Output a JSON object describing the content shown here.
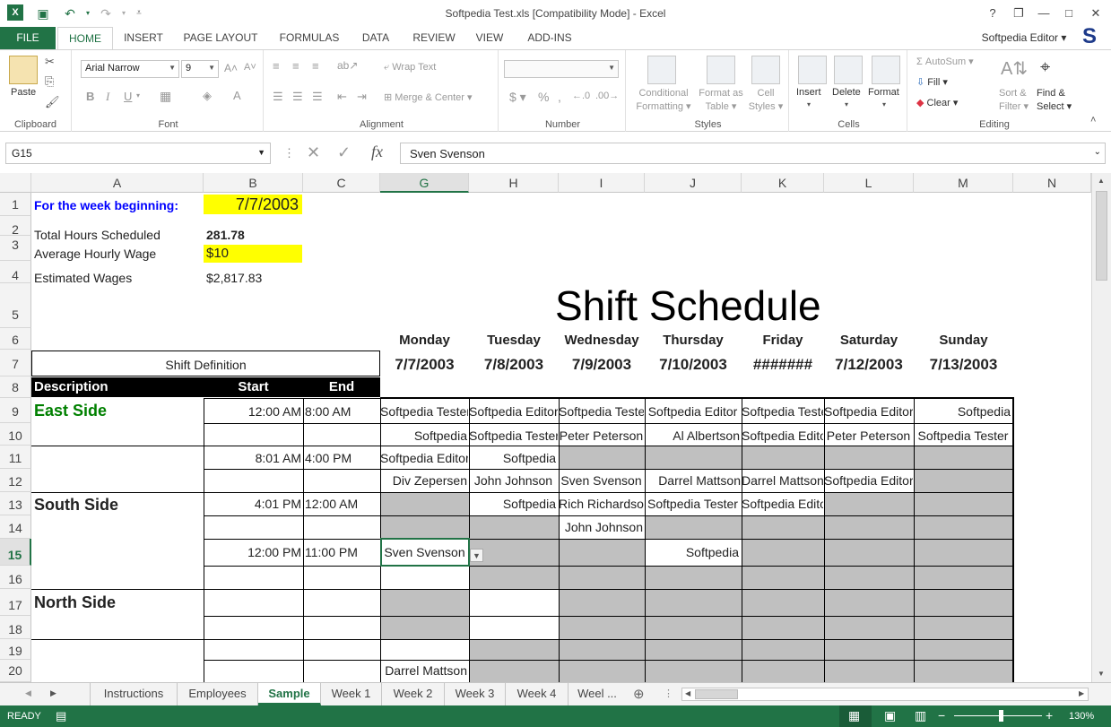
{
  "window": {
    "title": "Softpedia Test.xls  [Compatibility Mode] - Excel",
    "help": "?",
    "minimize": "—",
    "restore": "❐",
    "close": "✕"
  },
  "ribbon_tabs": [
    "FILE",
    "HOME",
    "INSERT",
    "PAGE LAYOUT",
    "FORMULAS",
    "DATA",
    "REVIEW",
    "VIEW",
    "ADD-INS"
  ],
  "user": "Softpedia Editor",
  "ribbon": {
    "clipboard": {
      "label": "Clipboard",
      "paste": "Paste"
    },
    "font": {
      "label": "Font",
      "font_name": "Arial Narrow",
      "font_size": "9"
    },
    "alignment": {
      "label": "Alignment",
      "wrap_text": "Wrap Text",
      "merge_center": "Merge & Center"
    },
    "number": {
      "label": "Number"
    },
    "styles": {
      "label": "Styles",
      "conditional1": "Conditional",
      "conditional2": "Formatting",
      "format_as1": "Format as",
      "format_as2": "Table",
      "cell_styles1": "Cell",
      "cell_styles2": "Styles"
    },
    "cells": {
      "label": "Cells",
      "insert": "Insert",
      "delete": "Delete",
      "format": "Format"
    },
    "editing": {
      "label": "Editing",
      "autosum": "AutoSum",
      "fill": "Fill",
      "clear": "Clear",
      "sort1": "Sort &",
      "sort2": "Filter",
      "find1": "Find &",
      "find2": "Select"
    }
  },
  "formula_bar": {
    "name_box": "G15",
    "value": "Sven Svenson"
  },
  "columns": [
    "A",
    "B",
    "C",
    "G",
    "H",
    "I",
    "J",
    "K",
    "L",
    "M",
    "N"
  ],
  "rows": [
    "1",
    "2",
    "3",
    "4",
    "5",
    "6",
    "7",
    "8",
    "9",
    "10",
    "11",
    "12",
    "13",
    "14",
    "15",
    "16",
    "17",
    "18",
    "19",
    "20"
  ],
  "sheet": {
    "week_label": "For the week beginning:",
    "week_value": "7/7/2003",
    "total_hours_label": "Total Hours Scheduled",
    "total_hours_value": "281.78",
    "avg_wage_label": "Average Hourly Wage",
    "avg_wage_value": "$10",
    "est_wages_label": "Estimated Wages",
    "est_wages_value": "$2,817.83",
    "title": "Shift Schedule",
    "shift_definition": "Shift Definition",
    "desc_hdr": "Description",
    "start_hdr": "Start",
    "end_hdr": "End",
    "days": [
      "Monday",
      "Tuesday",
      "Wednesday",
      "Thursday",
      "Friday",
      "Saturday",
      "Sunday"
    ],
    "dates": [
      "7/7/2003",
      "7/8/2003",
      "7/9/2003",
      "7/10/2003",
      "#######",
      "7/12/2003",
      "7/13/2003"
    ],
    "east": "East Side",
    "south": "South Side",
    "north": "North Side",
    "times": {
      "r9s": "12:00 AM",
      "r9e": "8:00 AM",
      "r11s": "8:01 AM",
      "r11e": "4:00 PM",
      "r13s": "4:01 PM",
      "r13e": "12:00 AM",
      "r15s": "12:00 PM",
      "r15e": "11:00 PM"
    },
    "r9": [
      "Softpedia Tester",
      "Softpedia Editor",
      "Softpedia Tester",
      "Softpedia Editor",
      "Softpedia Tester",
      "Softpedia Editor",
      "Softpedia"
    ],
    "r10": [
      "Softpedia",
      "Softpedia Tester",
      "Peter Peterson",
      "Al Albertson",
      "Softpedia Editor",
      "Peter Peterson",
      "Softpedia Tester"
    ],
    "r11": [
      "Softpedia Editor",
      "Softpedia"
    ],
    "r12": [
      "Div Zepersen",
      "John Johnson",
      "Sven Svenson",
      "Darrel Mattson",
      "Darrel Mattson",
      "Softpedia Editor"
    ],
    "r13": [
      "Softpedia",
      "Rich Richardson",
      "Softpedia Tester",
      "Softpedia Editor"
    ],
    "r14": [
      "John Johnson"
    ],
    "r15": [
      "Sven Svenson",
      "Softpedia"
    ],
    "r20": [
      "Darrel Mattson"
    ]
  },
  "sheet_tabs": [
    "Instructions",
    "Employees",
    "Sample",
    "Week 1",
    "Week 2",
    "Week 3",
    "Week 4",
    "Weel ..."
  ],
  "status": {
    "ready": "READY",
    "zoom": "130%"
  },
  "colors": {
    "excel_green": "#217346",
    "highlight_yellow": "#ffff00",
    "label_blue": "#0000ff",
    "east_green": "#008000",
    "shade_gray": "#c0c0c0"
  }
}
